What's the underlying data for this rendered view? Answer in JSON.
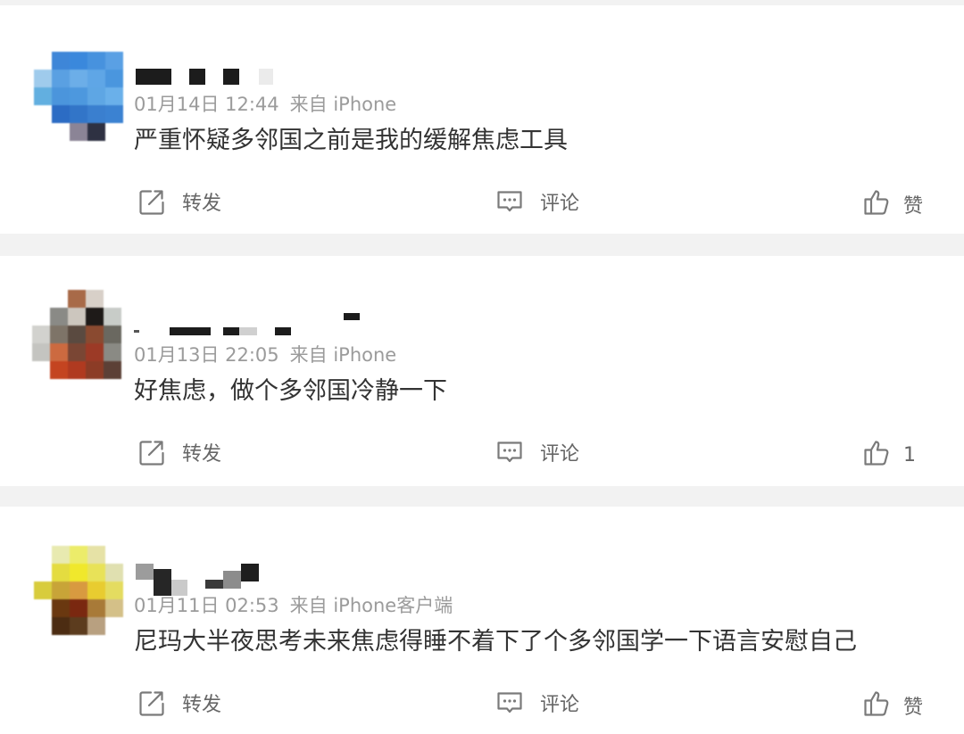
{
  "theme": {
    "page_bg": "#f2f2f2",
    "card_bg": "#ffffff",
    "text_color": "#333333",
    "meta_color": "#9b9b9b",
    "action_color": "#666666",
    "icon_color": "#7a7a7a"
  },
  "comments": [
    {
      "time": "01月14日 12:44",
      "source": "来自 iPhone",
      "text": "严重怀疑多邻国之前是我的缓解焦虑工具",
      "actions": {
        "repost": {
          "icon": "repost-icon",
          "label": "转发"
        },
        "comment": {
          "icon": "comment-icon",
          "label": "评论"
        },
        "like": {
          "icon": "like-icon",
          "label": "赞"
        }
      }
    },
    {
      "time": "01月13日 22:05",
      "source": "来自 iPhone",
      "text": "好焦虑，做个多邻国冷静一下",
      "actions": {
        "repost": {
          "icon": "repost-icon",
          "label": "转发"
        },
        "comment": {
          "icon": "comment-icon",
          "label": "评论"
        },
        "like": {
          "icon": "like-icon",
          "label": "1"
        }
      }
    },
    {
      "time": "01月11日 02:53",
      "source": "来自 iPhone客户端",
      "text": "尼玛大半夜思考未来焦虑得睡不着下了个多邻国学一下语言安慰自己",
      "actions": {
        "repost": {
          "icon": "repost-icon",
          "label": "转发"
        },
        "comment": {
          "icon": "comment-icon",
          "label": "评论"
        },
        "like": {
          "icon": "like-icon",
          "label": "赞"
        }
      }
    }
  ]
}
